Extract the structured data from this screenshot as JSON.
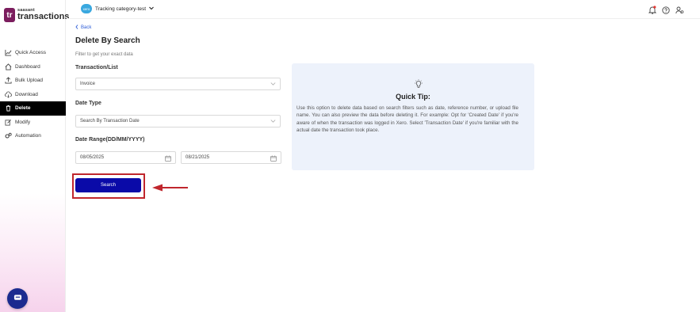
{
  "brand": {
    "small": "saasant",
    "big": "transactions",
    "mark": "tr"
  },
  "sidebar": {
    "items": [
      {
        "label": "Quick Access",
        "icon": "chart-line-icon"
      },
      {
        "label": "Dashboard",
        "icon": "home-icon"
      },
      {
        "label": "Bulk Upload",
        "icon": "upload-icon"
      },
      {
        "label": "Download",
        "icon": "cloud-download-icon"
      },
      {
        "label": "Delete",
        "icon": "trash-icon"
      },
      {
        "label": "Modify",
        "icon": "edit-icon"
      },
      {
        "label": "Automation",
        "icon": "gears-icon"
      }
    ],
    "active": "Delete"
  },
  "topbar": {
    "org_badge": "xero",
    "org_name": "Tracking category-test"
  },
  "main": {
    "back": "Back",
    "title": "Delete By Search",
    "subtitle": "Filter to get your exact data",
    "transaction_label": "Transaction/List",
    "transaction_value": "Invoice",
    "date_type_label": "Date Type",
    "date_type_value": "Search By Transaction Date",
    "date_range_label": "Date Range(DD/MM/YYYY)",
    "date_from": "08/05/2025",
    "date_to": "08/21/2025",
    "search_button": "Search"
  },
  "tip": {
    "title": "Quick Tip:",
    "body": "Use this option to delete data based on search filters such as date, reference number, or upload file name. You can also preview the data before deleting it. For example: Opt for 'Created Date' if you're aware of when the transaction was logged in Xero. Select 'Transaction Date' if you're familiar with the actual date the transaction took place."
  },
  "colors": {
    "accent": "#0a0aa8",
    "active_nav": "#000000",
    "highlight": "#c0262d",
    "brand": "#7b1d5e",
    "tip_bg": "#edf2fb"
  }
}
